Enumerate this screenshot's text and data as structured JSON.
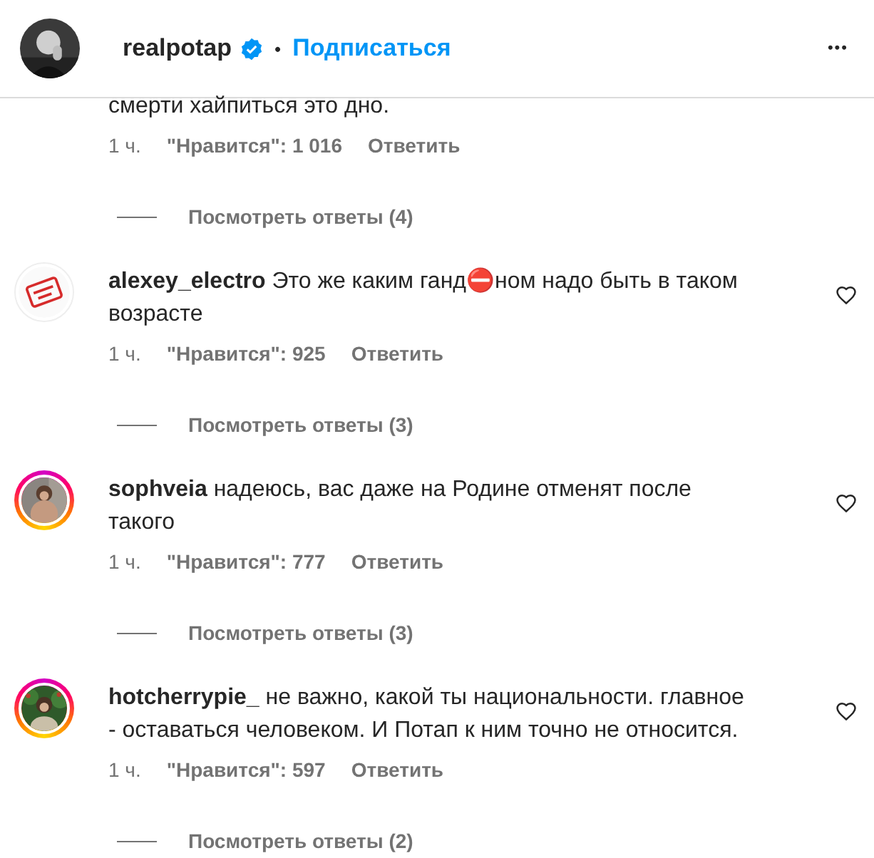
{
  "header": {
    "username": "realpotap",
    "verified": true,
    "separator": "•",
    "follow": "Подписаться",
    "more": "•••"
  },
  "comments": [
    {
      "text": "смерти хайпиться это дно.",
      "time": "1 ч.",
      "likes": "\"Нравится\": 1 016",
      "reply": "Ответить",
      "view_replies": "Посмотреть ответы (4)"
    },
    {
      "username": "alexey_electro",
      "text": "Это же каким ганд⛔ном надо быть в таком возрасте",
      "time": "1 ч.",
      "likes": "\"Нравится\": 925",
      "reply": "Ответить",
      "view_replies": "Посмотреть ответы (3)",
      "story_ring": false,
      "liked": false
    },
    {
      "username": "sophveia",
      "text": "надеюсь, вас даже на Родине отменят после такого",
      "time": "1 ч.",
      "likes": "\"Нравится\": 777",
      "reply": "Ответить",
      "view_replies": "Посмотреть ответы (3)",
      "story_ring": true,
      "liked": false
    },
    {
      "username": "hotcherrypie_",
      "text": "не важно, какой ты национальности. главное - оставаться человеком. И Потап к ним точно не относится.",
      "time": "1 ч.",
      "likes": "\"Нравится\": 597",
      "reply": "Ответить",
      "view_replies": "Посмотреть ответы (2)",
      "story_ring": true,
      "liked": false
    }
  ]
}
